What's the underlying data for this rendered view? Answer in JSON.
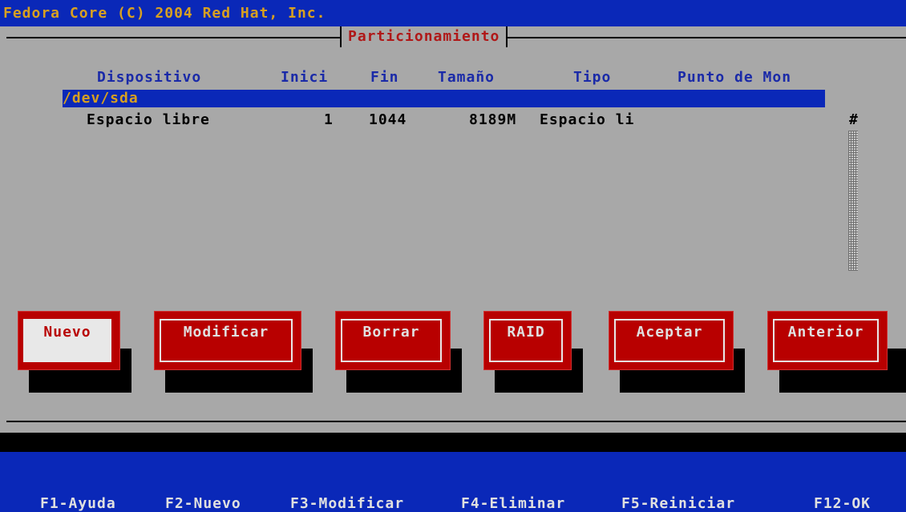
{
  "header": {
    "title": "Fedora Core (C) 2004 Red Hat, Inc."
  },
  "window": {
    "title": "Particionamiento"
  },
  "table": {
    "columns": [
      "Dispositivo",
      "Inici",
      "Fin",
      "Tamaño",
      "Tipo",
      "Punto de Mon"
    ],
    "drive": "/dev/sda",
    "rows": [
      {
        "device": "Espacio libre",
        "start": "1",
        "end": "1044",
        "size": "8189M",
        "type": "Espacio li"
      }
    ]
  },
  "scrollbar": {
    "marker": "#"
  },
  "buttons": {
    "nuevo": "Nuevo",
    "modificar": "Modificar",
    "borrar": "Borrar",
    "raid": "RAID",
    "aceptar": "Aceptar",
    "anterior": "Anterior"
  },
  "fkeys": {
    "f1": "F1-Ayuda",
    "f2": "F2-Nuevo",
    "f3": "F3-Modificar",
    "f4": "F4-Eliminar",
    "f5": "F5-Reiniciar",
    "f12": "F12-OK"
  },
  "colors": {
    "background": "#0a28b8",
    "window": "#a8a8a8",
    "button": "#b80000",
    "header_text": "#d8a020",
    "title_text": "#b01818"
  }
}
